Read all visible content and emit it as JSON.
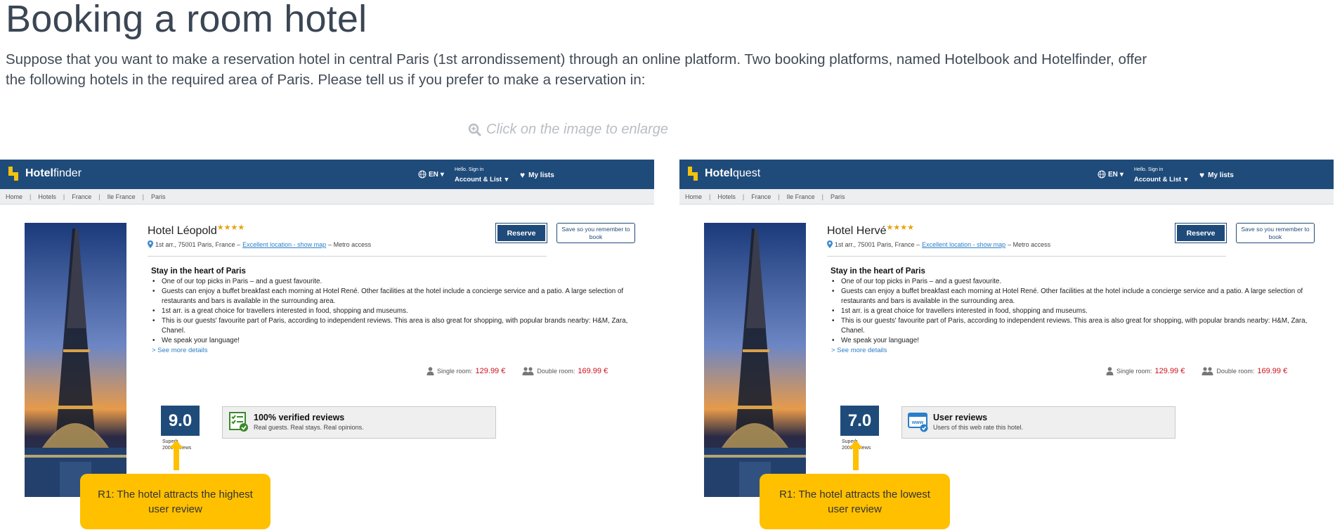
{
  "page": {
    "title": "Booking a room hotel",
    "intro": "Suppose that you want to make a reservation hotel in central Paris (1st arrondissement) through an online platform. Two booking platforms, named Hotelbook and Hotelfinder, offer the following hotels in the required area of Paris. Please tell us if you prefer to make a reservation in:",
    "enlarge_hint": "Click on the image to enlarge"
  },
  "colors": {
    "brand": "#1f4b7a",
    "accent": "#ffc000",
    "price": "#d0101b",
    "link": "#2a7fc9",
    "logo": "#f4c20d"
  },
  "panels": [
    {
      "brand_bold": "Hotel",
      "brand_light": "finder",
      "lang": "EN",
      "hello": "Hello. Sign in",
      "account": "Account & List",
      "my_lists": "My lists",
      "breadcrumbs": [
        "Home",
        "Hotels",
        "France",
        "Ile France",
        "Paris"
      ],
      "hotel_name": "Hotel Léopold",
      "stars": "★★★★",
      "address": "1st arr., 75001 Paris, France –",
      "location_link": "Excellent location - show map",
      "metro": "– Metro access",
      "reserve": "Reserve",
      "save": "Save so you remember to book",
      "desc_title": "Stay in the heart of Paris",
      "bullets": [
        "One of our top picks in Paris – and a guest favourite.",
        "Guests can enjoy a buffet breakfast each morning at Hotel René. Other facilities at the hotel include a concierge service and a patio. A large selection of restaurants and bars is available in the surrounding area.",
        "1st arr. is a great choice for travellers interested in food, shopping and museums.",
        "This is our guests' favourite part of Paris, according to independent reviews. This area is also great for shopping, with popular brands nearby: H&M, Zara, Chanel.",
        "We speak your language!"
      ],
      "see_more": "> See more details",
      "single_label": "Single room:",
      "single_price": "129.99 €",
      "double_label": "Double room:",
      "double_price": "169.99 €",
      "score": "9.0",
      "score_sub1": "Superb",
      "score_sub2": "2000 reviews",
      "review_icon": "checklist-icon",
      "review_title": "100% verified reviews",
      "review_sub": "Real guests. Real stays. Real opinions.",
      "callout": "R1: The hotel attracts the highest user review"
    },
    {
      "brand_bold": "Hotel",
      "brand_light": "quest",
      "lang": "EN",
      "hello": "Hello. Sign in",
      "account": "Account & List",
      "my_lists": "My lists",
      "breadcrumbs": [
        "Home",
        "Hotels",
        "France",
        "Ile France",
        "Paris"
      ],
      "hotel_name": "Hotel Hervé",
      "stars": "★★★★",
      "address": "1st arr., 75001 Paris, France –",
      "location_link": "Excellent location - show map",
      "metro": "– Metro access",
      "reserve": "Reserve",
      "save": "Save so you remember to book",
      "desc_title": "Stay in the heart of Paris",
      "bullets": [
        "One of our top picks in Paris – and a guest favourite.",
        "Guests can enjoy a buffet breakfast each morning at Hotel René. Other facilities at the hotel include a concierge service and a patio. A large selection of restaurants and bars is available in the surrounding area.",
        "1st arr. is a great choice for travellers interested in food, shopping and museums.",
        "This is our guests' favourite part of Paris, according to independent reviews. This area is also great for shopping, with popular brands nearby: H&M, Zara, Chanel.",
        "We speak your language!"
      ],
      "see_more": "> See more details",
      "single_label": "Single room:",
      "single_price": "129.99 €",
      "double_label": "Double room:",
      "double_price": "169.99 €",
      "score": "7.0",
      "score_sub1": "Superb",
      "score_sub2": "2000 reviews",
      "review_icon": "www-badge-icon",
      "review_title": "User reviews",
      "review_sub": "Users of this web rate this hotel.",
      "callout": "R1: The hotel attracts the lowest user review"
    }
  ]
}
